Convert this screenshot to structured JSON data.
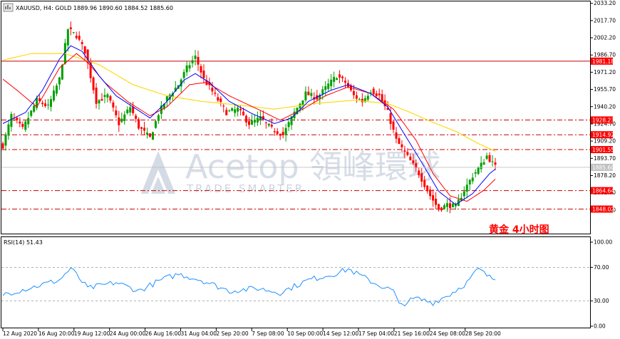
{
  "header": {
    "text": "XAUUSD, H4:  GOLD  1889.96 1890.60 1884.52 1885.60"
  },
  "rsi_header": {
    "text": "RSI(14) 51.43"
  },
  "caption": "黄金  4小时图",
  "watermark": {
    "brand": "Acetop 領峰環球",
    "tagline": "TRADE SMARTER"
  },
  "colors": {
    "bull": "#00a000",
    "bear": "#ff0000",
    "ma_fast": "#0000ff",
    "ma_mid": "#ff0000",
    "ma_slow": "#ffd700",
    "rsi": "#1e90ff",
    "level_line": "#cc0000",
    "level_label_bg": "#ff0000",
    "price_label_bg": "#c0c0c0"
  },
  "chart_data": [
    {
      "type": "candlestick",
      "symbol": "XAUUSD",
      "timeframe": "H4",
      "ylim": [
        1833,
        2033
      ],
      "y_ticks": [
        "2033.20",
        "2017.70",
        "2002.20",
        "1986.70",
        "1971.20",
        "1955.70",
        "1940.20",
        "1924.70",
        "1909.20",
        "1893.70",
        "1878.20",
        "1862.70",
        "1847.20"
      ],
      "last_price": "1885.60",
      "levels": [
        {
          "value": 1981.18,
          "label": "1981.18",
          "style": "solid"
        },
        {
          "value": 1928.23,
          "label": "1928.23",
          "style": "dashdot"
        },
        {
          "value": 1914.92,
          "label": "1914.92",
          "style": "dashdot"
        },
        {
          "value": 1901.55,
          "label": "1901.55",
          "style": "dashdot"
        },
        {
          "value": 1864.64,
          "label": "1864.64",
          "style": "dashdot"
        },
        {
          "value": 1848.02,
          "label": "1848.02",
          "style": "dashdot"
        }
      ],
      "x_labels": [
        "12 Aug 2020",
        "16 Aug 20:00",
        "19 Aug 12:00",
        "24 Aug 00:00",
        "26 Aug 16:00",
        "31 Aug 04:00",
        "2 Sep 20:00",
        "7 Sep 08:00",
        "10 Sep 00:00",
        "14 Sep 12:00",
        "17 Sep 04:00",
        "21 Sep 16:00",
        "24 Sep 08:00",
        "28 Sep 20:00"
      ],
      "close_anchors": [
        [
          0,
          1905
        ],
        [
          3,
          1932
        ],
        [
          7,
          1920
        ],
        [
          12,
          1946
        ],
        [
          16,
          1940
        ],
        [
          20,
          1965
        ],
        [
          23,
          2010
        ],
        [
          26,
          2004
        ],
        [
          29,
          1990
        ],
        [
          33,
          1945
        ],
        [
          37,
          1950
        ],
        [
          41,
          1925
        ],
        [
          45,
          1940
        ],
        [
          48,
          1922
        ],
        [
          52,
          1912
        ],
        [
          55,
          1934
        ],
        [
          58,
          1948
        ],
        [
          62,
          1960
        ],
        [
          65,
          1975
        ],
        [
          68,
          1985
        ],
        [
          71,
          1965
        ],
        [
          75,
          1950
        ],
        [
          79,
          1935
        ],
        [
          83,
          1938
        ],
        [
          87,
          1925
        ],
        [
          91,
          1930
        ],
        [
          95,
          1920
        ],
        [
          99,
          1915
        ],
        [
          103,
          1935
        ],
        [
          107,
          1952
        ],
        [
          111,
          1948
        ],
        [
          115,
          1960
        ],
        [
          118,
          1968
        ],
        [
          121,
          1962
        ],
        [
          124,
          1950
        ],
        [
          127,
          1945
        ],
        [
          130,
          1955
        ],
        [
          133,
          1950
        ],
        [
          136,
          1935
        ],
        [
          139,
          1910
        ],
        [
          143,
          1895
        ],
        [
          147,
          1880
        ],
        [
          151,
          1860
        ],
        [
          154,
          1848
        ],
        [
          157,
          1852
        ],
        [
          160,
          1850
        ],
        [
          163,
          1865
        ],
        [
          166,
          1878
        ],
        [
          169,
          1888
        ],
        [
          171,
          1896
        ],
        [
          174,
          1886
        ]
      ],
      "ma_fast_anchors": [
        [
          0,
          1925
        ],
        [
          8,
          1935
        ],
        [
          14,
          1955
        ],
        [
          20,
          1983
        ],
        [
          24,
          1995
        ],
        [
          28,
          1990
        ],
        [
          34,
          1968
        ],
        [
          40,
          1950
        ],
        [
          46,
          1940
        ],
        [
          52,
          1930
        ],
        [
          58,
          1945
        ],
        [
          64,
          1964
        ],
        [
          68,
          1970
        ],
        [
          73,
          1962
        ],
        [
          80,
          1945
        ],
        [
          88,
          1934
        ],
        [
          96,
          1925
        ],
        [
          102,
          1930
        ],
        [
          108,
          1945
        ],
        [
          116,
          1955
        ],
        [
          122,
          1960
        ],
        [
          130,
          1952
        ],
        [
          136,
          1940
        ],
        [
          142,
          1915
        ],
        [
          148,
          1890
        ],
        [
          154,
          1864
        ],
        [
          160,
          1852
        ],
        [
          166,
          1862
        ],
        [
          172,
          1880
        ],
        [
          174,
          1884
        ]
      ],
      "ma_mid_anchors": [
        [
          0,
          1965
        ],
        [
          5,
          1955
        ],
        [
          12,
          1940
        ],
        [
          20,
          1975
        ],
        [
          26,
          1988
        ],
        [
          30,
          1980
        ],
        [
          36,
          1962
        ],
        [
          44,
          1945
        ],
        [
          52,
          1932
        ],
        [
          58,
          1940
        ],
        [
          66,
          1960
        ],
        [
          72,
          1962
        ],
        [
          80,
          1950
        ],
        [
          90,
          1938
        ],
        [
          98,
          1928
        ],
        [
          106,
          1938
        ],
        [
          114,
          1950
        ],
        [
          122,
          1958
        ],
        [
          130,
          1952
        ],
        [
          138,
          1938
        ],
        [
          146,
          1910
        ],
        [
          152,
          1880
        ],
        [
          158,
          1860
        ],
        [
          164,
          1855
        ],
        [
          170,
          1865
        ],
        [
          174,
          1875
        ]
      ],
      "ma_slow_anchors": [
        [
          0,
          1982
        ],
        [
          10,
          1988
        ],
        [
          22,
          1988
        ],
        [
          34,
          1978
        ],
        [
          46,
          1960
        ],
        [
          58,
          1950
        ],
        [
          70,
          1945
        ],
        [
          82,
          1942
        ],
        [
          96,
          1938
        ],
        [
          110,
          1943
        ],
        [
          124,
          1946
        ],
        [
          136,
          1943
        ],
        [
          144,
          1935
        ],
        [
          152,
          1926
        ],
        [
          160,
          1918
        ],
        [
          168,
          1907
        ],
        [
          174,
          1900
        ]
      ]
    },
    {
      "type": "line",
      "name": "RSI(14)",
      "ylim": [
        0,
        100
      ],
      "y_ticks": [
        "100.00",
        "70.00",
        "30.00",
        "0.00"
      ],
      "value_anchors": [
        [
          0,
          38
        ],
        [
          10,
          46
        ],
        [
          20,
          55
        ],
        [
          24,
          69
        ],
        [
          30,
          45
        ],
        [
          40,
          52
        ],
        [
          48,
          42
        ],
        [
          56,
          55
        ],
        [
          62,
          62
        ],
        [
          70,
          55
        ],
        [
          80,
          42
        ],
        [
          90,
          45
        ],
        [
          98,
          40
        ],
        [
          108,
          55
        ],
        [
          118,
          63
        ],
        [
          122,
          68
        ],
        [
          132,
          50
        ],
        [
          138,
          42
        ],
        [
          140,
          25
        ],
        [
          146,
          33
        ],
        [
          152,
          28
        ],
        [
          158,
          38
        ],
        [
          164,
          52
        ],
        [
          168,
          68
        ],
        [
          172,
          58
        ],
        [
          174,
          56
        ]
      ]
    }
  ]
}
